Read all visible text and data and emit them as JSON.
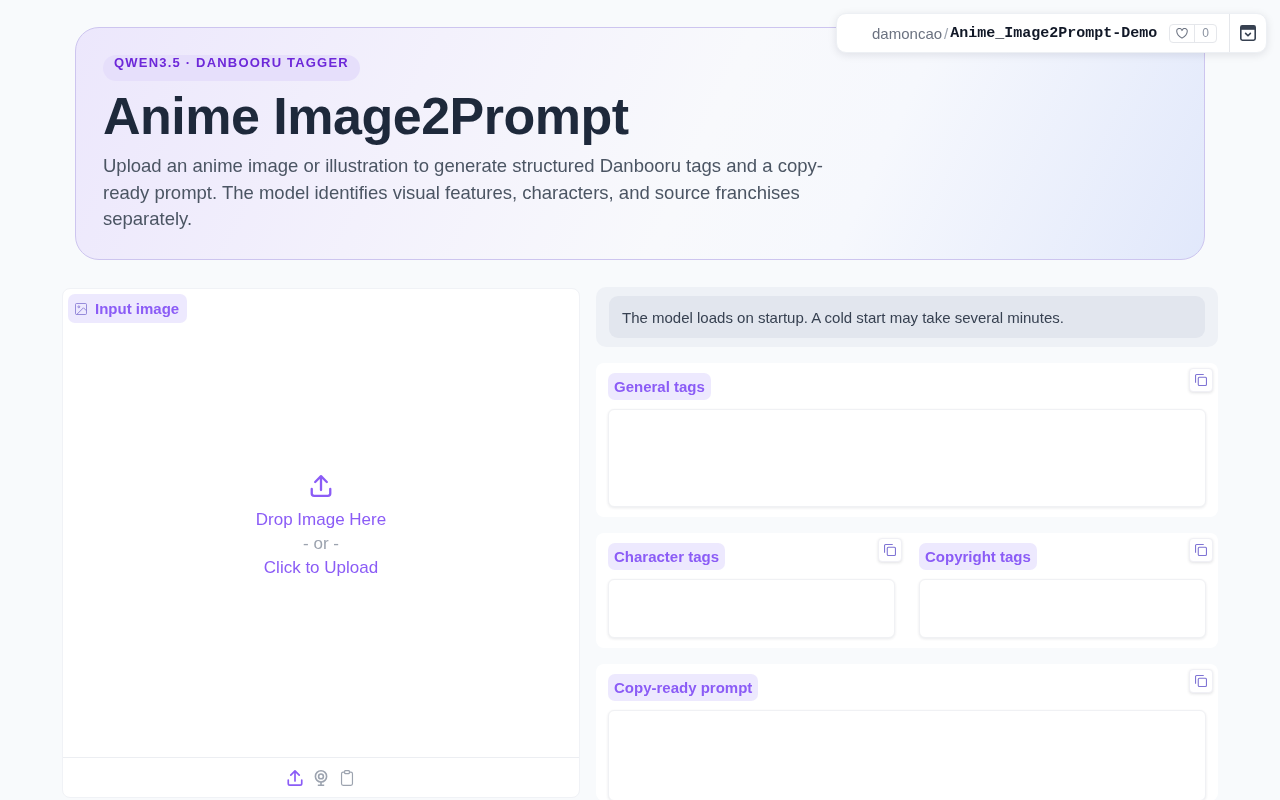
{
  "header_bar": {
    "owner": "damoncao",
    "separator": "/",
    "space_name": "Anime_Image2Prompt-Demo",
    "likes": "0"
  },
  "hero": {
    "badge": "QWEN3.5 · DANBOORU TAGGER",
    "title": "Anime Image2Prompt",
    "description": "Upload an anime image or illustration to generate structured Danbooru tags and a copy-ready prompt. The model identifies visual features, characters, and source franchises separately."
  },
  "input_panel": {
    "label": "Input image",
    "drop_text": "Drop Image Here",
    "or_text": "- or -",
    "click_text": "Click to Upload",
    "sources": [
      {
        "kind": "upload",
        "selected": true
      },
      {
        "kind": "webcam",
        "selected": false
      },
      {
        "kind": "clipboard",
        "selected": false
      }
    ]
  },
  "notice": {
    "message": "The model loads on startup. A cold start may take several minutes."
  },
  "output_groups": [
    {
      "fields": [
        {
          "label": "General tags"
        }
      ]
    },
    {
      "fields": [
        {
          "label": "Character tags"
        },
        {
          "label": "Copyright tags"
        }
      ]
    },
    {
      "fields": [
        {
          "label": "Copy-ready prompt"
        }
      ]
    }
  ]
}
